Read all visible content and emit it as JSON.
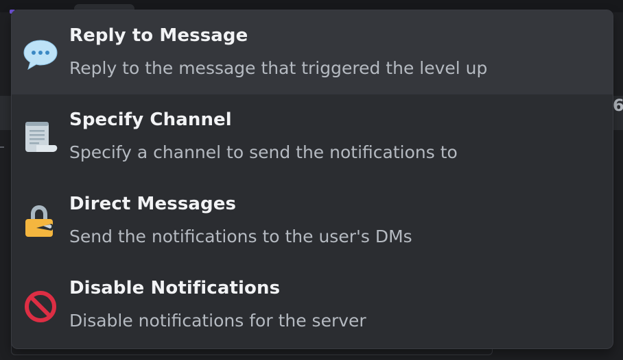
{
  "menu": {
    "options": [
      {
        "title": "Reply to Message",
        "description": "Reply to the message that triggered the level up",
        "icon": "speech-bubble-icon"
      },
      {
        "title": "Specify Channel",
        "description": "Specify a channel to send the notifications to",
        "icon": "scroll-page-icon"
      },
      {
        "title": "Direct Messages",
        "description": "Send the notifications to the user's DMs",
        "icon": "locked-with-pen-icon"
      },
      {
        "title": "Disable Notifications",
        "description": "Disable notifications for the server",
        "icon": "prohibited-icon"
      }
    ]
  },
  "background": {
    "partial_digit": "6"
  },
  "colors": {
    "menu_background": "#2b2d31",
    "hover_background": "#35373c",
    "title_text": "#f2f3f5",
    "description_text": "#b5bac1",
    "prohibited_red": "#dd2e44",
    "lock_gold": "#f4b63f"
  }
}
